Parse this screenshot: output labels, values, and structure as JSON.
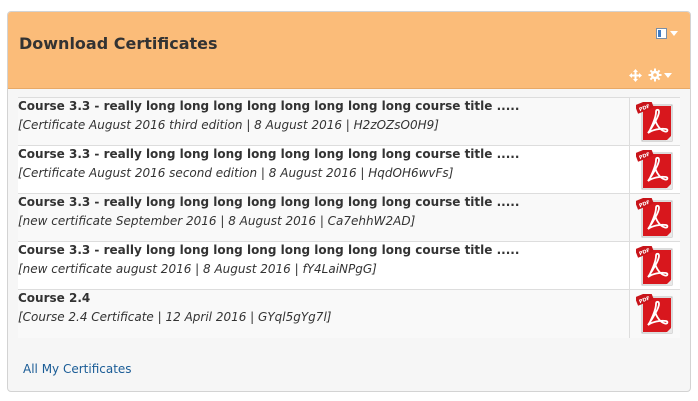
{
  "block": {
    "title": "Download Certificates",
    "icons": {
      "dock": "dock-icon",
      "move": "move-icon",
      "settings": "gear-icon"
    },
    "colors": {
      "header_bg": "#fbbc79",
      "link": "#1a5c96",
      "pdf_red": "#d8171d"
    }
  },
  "certificates": [
    {
      "course": "Course 3.3 - really long long long long long long long long course title .....",
      "details": "[Certificate August 2016 third edition | 8 August 2016 | H2zOZsO0H9]",
      "icon": "pdf-download-icon"
    },
    {
      "course": "Course 3.3 - really long long long long long long long long course title .....",
      "details": "[Certificate August 2016 second edition | 8 August 2016 | HqdOH6wvFs]",
      "icon": "pdf-download-icon"
    },
    {
      "course": "Course 3.3 - really long long long long long long long long course title .....",
      "details": "[new certificate September 2016 | 8 August 2016 | Ca7ehhW2AD]",
      "icon": "pdf-download-icon"
    },
    {
      "course": "Course 3.3 - really long long long long long long long long course title .....",
      "details": "[new certificate august 2016 | 8 August 2016 | fY4LaiNPgG]",
      "icon": "pdf-download-icon"
    },
    {
      "course": "Course 2.4",
      "details": "[Course 2.4 Certificate | 12 April 2016 | GYql5gYg7l]",
      "icon": "pdf-download-icon"
    }
  ],
  "footer": {
    "link_label": "All My Certificates"
  }
}
